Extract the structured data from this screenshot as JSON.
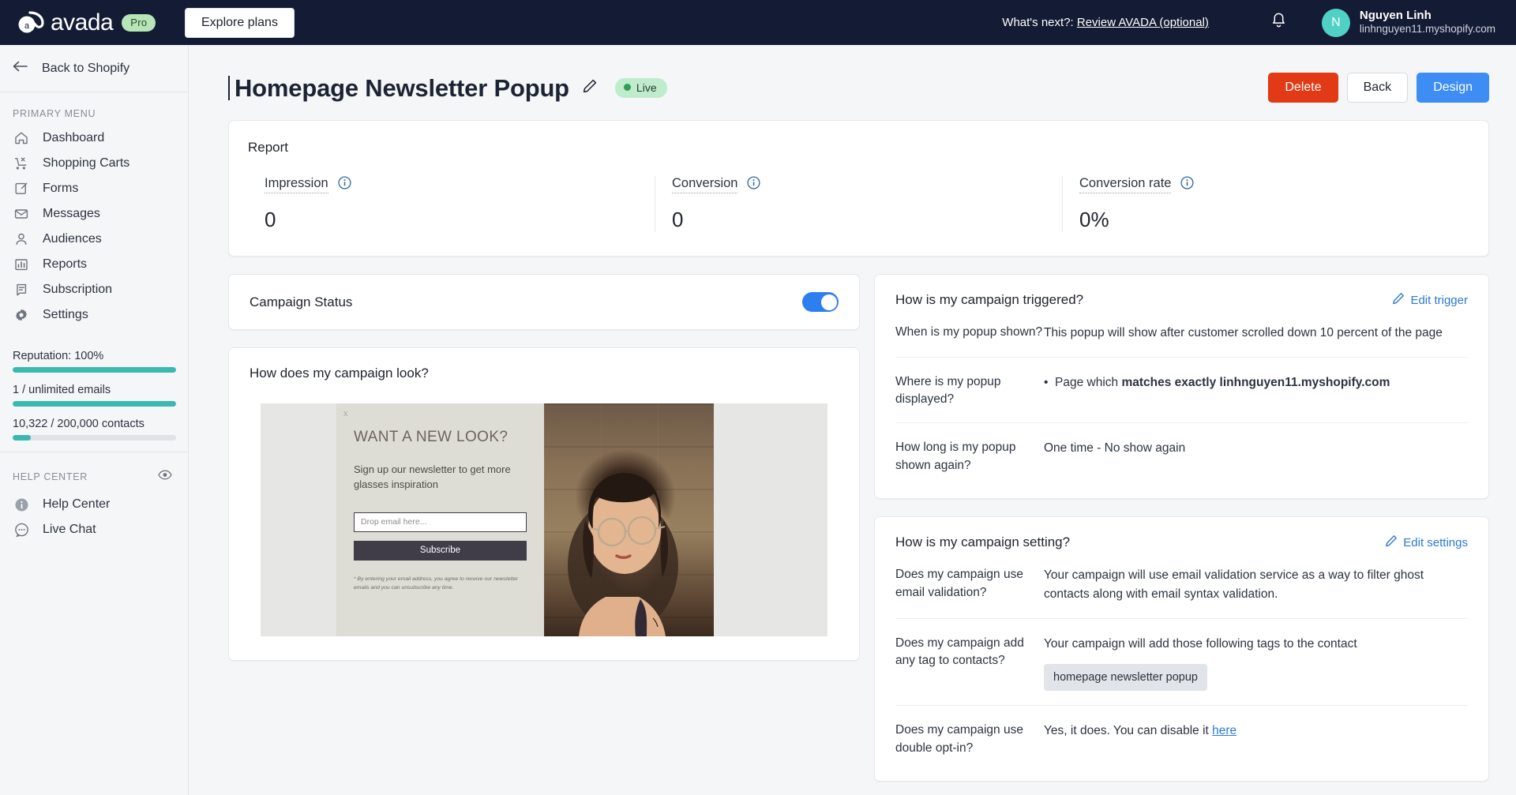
{
  "topbar": {
    "brand_name": "avada",
    "plan_chip": "Pro",
    "explore_label": "Explore plans",
    "whats_next_prefix": "What's next?:",
    "whats_next_link": "Review AVADA (optional)",
    "user_name": "Nguyen Linh",
    "user_shop": "linhnguyen11.myshopify.com",
    "avatar_initial": "N",
    "bell_icon": "bell-icon"
  },
  "sidebar": {
    "back_label": "Back to Shopify",
    "primary_menu_label": "PRIMARY MENU",
    "items": [
      {
        "label": "Dashboard",
        "icon": "home-icon"
      },
      {
        "label": "Shopping Carts",
        "icon": "abandoned-cart-icon"
      },
      {
        "label": "Forms",
        "icon": "form-icon"
      },
      {
        "label": "Messages",
        "icon": "envelope-icon"
      },
      {
        "label": "Audiences",
        "icon": "person-icon"
      },
      {
        "label": "Reports",
        "icon": "bar-chart-icon"
      },
      {
        "label": "Subscription",
        "icon": "receipt-icon"
      },
      {
        "label": "Settings",
        "icon": "gear-icon"
      }
    ],
    "meters": [
      {
        "label": "Reputation: 100%",
        "percent": 100
      },
      {
        "label": "1 / unlimited emails",
        "percent": 100
      },
      {
        "label": "10,322 / 200,000 contacts",
        "percent": 5
      }
    ],
    "help_center_label": "HELP CENTER",
    "eye_icon": "eye-icon",
    "help_items": [
      {
        "label": "Help Center",
        "icon": "info-circle-icon"
      },
      {
        "label": "Live Chat",
        "icon": "chat-bubble-icon"
      }
    ]
  },
  "page": {
    "title": "Homepage Newsletter Popup",
    "edit_title_icon": "pencil-icon",
    "status_badge": "Live",
    "buttons": {
      "delete": "Delete",
      "back": "Back",
      "design": "Design"
    }
  },
  "report": {
    "title": "Report",
    "stats": [
      {
        "label": "Impression",
        "value": "0"
      },
      {
        "label": "Conversion",
        "value": "0"
      },
      {
        "label": "Conversion rate",
        "value": "0%"
      }
    ],
    "info_icon": "info-circle-icon"
  },
  "campaign_status": {
    "label": "Campaign Status",
    "enabled": true
  },
  "campaign_look": {
    "title": "How does my campaign look?",
    "popup": {
      "close_label": "x",
      "heading": "WANT A NEW LOOK?",
      "subheading": "Sign up our newsletter to get more glasses inspiration",
      "email_placeholder": "Drop email here...",
      "submit_label": "Subscribe",
      "fine_print": "* By entering your email address, you agree to receive our newsletter emails and you can unsubscribe any time.",
      "photo_alt": "woman-with-glasses-photo"
    }
  },
  "trigger_panel": {
    "title": "How is my campaign triggered?",
    "edit_label": "Edit trigger",
    "edit_icon": "pencil-icon",
    "rows": [
      {
        "question": "When is my popup shown?",
        "answer": "This popup will show after customer scrolled down 10 percent of the page"
      },
      {
        "question": "Where is my popup displayed?",
        "answer_prefix": "Page which ",
        "answer_strong": "matches exactly linhnguyen11.myshopify.com",
        "bulleted": true
      },
      {
        "question": "How long is my popup shown again?",
        "answer": "One time - No show again"
      }
    ]
  },
  "setting_panel": {
    "title": "How is my campaign setting?",
    "edit_label": "Edit settings",
    "edit_icon": "pencil-icon",
    "rows": [
      {
        "question": "Does my campaign use email validation?",
        "answer": "Your campaign will use email validation service as a way to filter ghost contacts along with email syntax validation."
      },
      {
        "question": "Does my campaign add any tag to contacts?",
        "answer": "Your campaign will add those following tags to the contact",
        "tag": "homepage newsletter popup"
      },
      {
        "question": "Does my campaign use double opt-in?",
        "answer": "Yes, it does. You can disable it ",
        "link": "here"
      }
    ]
  },
  "colors": {
    "topbar_bg": "#141b34",
    "accent_blue": "#3d8df5",
    "danger_red": "#e23a16",
    "teal": "#3ab9b0",
    "live_green": "#2f9e57",
    "link_blue": "#2b7ad1"
  }
}
